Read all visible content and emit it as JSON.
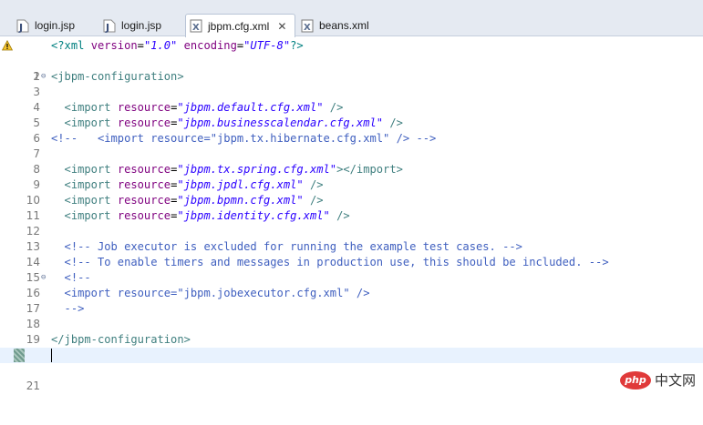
{
  "tabs": [
    {
      "label": "login.jsp",
      "icon": "jsp-file-icon",
      "active": false
    },
    {
      "label": "login.jsp",
      "icon": "jsp-file-icon",
      "active": false
    },
    {
      "label": "jbpm.cfg.xml",
      "icon": "xml-file-icon",
      "active": true,
      "close": "✕"
    },
    {
      "label": "beans.xml",
      "icon": "xml-file-icon",
      "active": false
    }
  ],
  "editor": {
    "line_numbers": [
      "1",
      "2",
      "3",
      "4",
      "5",
      "6",
      "7",
      "8",
      "9",
      "10",
      "11",
      "12",
      "13",
      "14",
      "15",
      "16",
      "17",
      "18",
      "19",
      "20",
      "21"
    ],
    "warning_line": "1",
    "current_line": "21",
    "fold_lines": [
      "3",
      "16"
    ],
    "fold_glyph": "⊖"
  },
  "code": {
    "l1": {
      "open": "<?xml ",
      "a1": "version",
      "eq1": "=",
      "v1": "\"1.0\"",
      "sp": " ",
      "a2": "encoding",
      "eq2": "=",
      "v2": "\"UTF-8\"",
      "close": "?>"
    },
    "l3": "<jbpm-configuration>",
    "l5": {
      "open": "  <import ",
      "attr": "resource",
      "eq": "=",
      "val": "\"jbpm.default.cfg.xml\"",
      "close": " />"
    },
    "l6": {
      "open": "  <import ",
      "attr": "resource",
      "eq": "=",
      "val": "\"jbpm.businesscalendar.cfg.xml\"",
      "close": " />"
    },
    "l7": "<!--   <import resource=\"jbpm.tx.hibernate.cfg.xml\" /> -->",
    "l9": {
      "open": "  <import ",
      "attr": "resource",
      "eq": "=",
      "val": "\"jbpm.tx.spring.cfg.xml\"",
      "close": "></import>"
    },
    "l10": {
      "open": "  <import ",
      "attr": "resource",
      "eq": "=",
      "val": "\"jbpm.jpdl.cfg.xml\"",
      "close": " />"
    },
    "l11": {
      "open": "  <import ",
      "attr": "resource",
      "eq": "=",
      "val": "\"jbpm.bpmn.cfg.xml\"",
      "close": " />"
    },
    "l12": {
      "open": "  <import ",
      "attr": "resource",
      "eq": "=",
      "val": "\"jbpm.identity.cfg.xml\"",
      "close": " />"
    },
    "l14": "  <!-- Job executor is excluded for running the example test cases. -->",
    "l15": "  <!-- To enable timers and messages in production use, this should be included. -->",
    "l16": "  <!--",
    "l17": "  <import resource=\"jbpm.jobexecutor.cfg.xml\" />",
    "l18": "  -->",
    "l20": "</jbpm-configuration>"
  },
  "watermark": {
    "logo": "php",
    "text": "中文网"
  },
  "colors": {
    "tag": "#3f7f7f",
    "attribute": "#7f007f",
    "value": "#2a00ff",
    "comment": "#3f5fbf",
    "current_line_bg": "#e8f2fe"
  }
}
